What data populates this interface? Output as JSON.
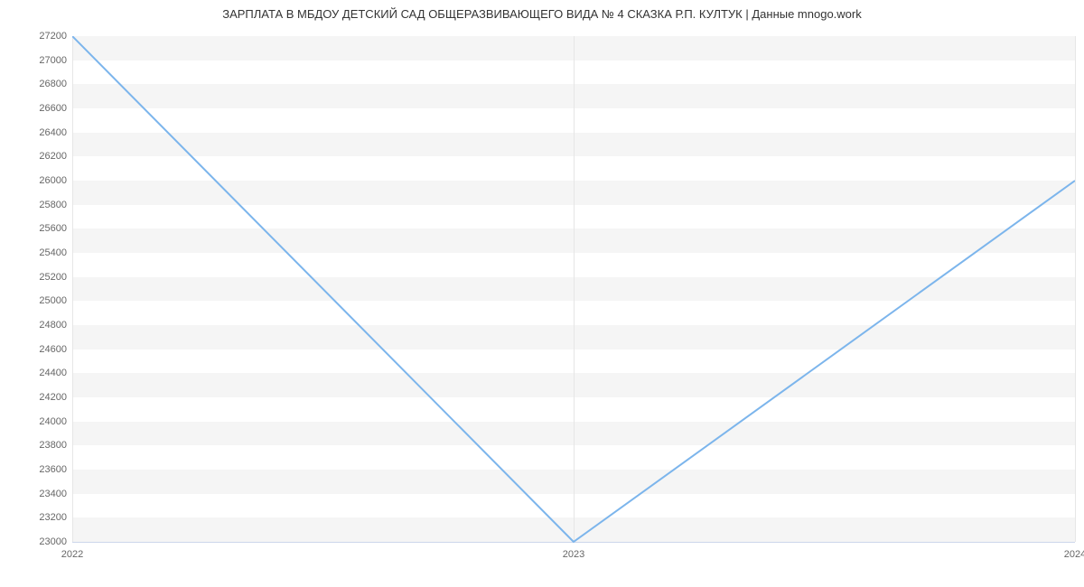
{
  "chart_data": {
    "type": "line",
    "title": "ЗАРПЛАТА В МБДОУ ДЕТСКИЙ САД ОБЩЕРАЗВИВАЮЩЕГО ВИДА № 4 СКАЗКА Р.П. КУЛТУК | Данные mnogo.work",
    "xlabel": "",
    "ylabel": "",
    "x": [
      "2022",
      "2023",
      "2024"
    ],
    "values": [
      27200,
      23000,
      26000
    ],
    "ylim": [
      23000,
      27200
    ],
    "yticks": [
      23000,
      23200,
      23400,
      23600,
      23800,
      24000,
      24200,
      24400,
      24600,
      24800,
      25000,
      25200,
      25400,
      25600,
      25800,
      26000,
      26200,
      26400,
      26600,
      26800,
      27000,
      27200
    ],
    "x_tick_labels": [
      "2022",
      "2023",
      "2024"
    ],
    "series_color": "#7cb5ec",
    "band_color": "#f5f5f5"
  }
}
